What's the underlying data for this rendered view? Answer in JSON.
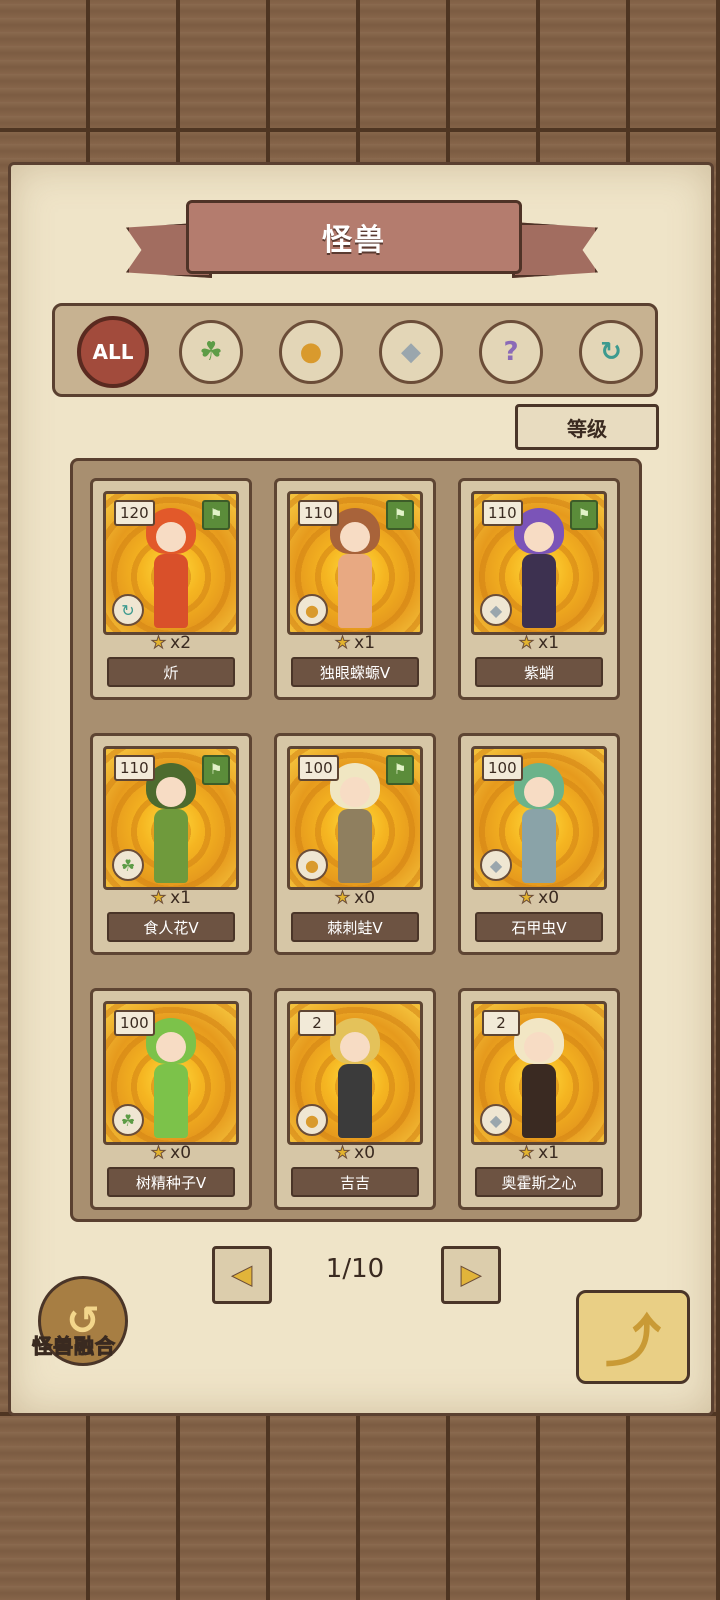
{
  "title": "怪兽",
  "filters": [
    {
      "label": "ALL",
      "icon": "all-icon",
      "active": true
    },
    {
      "label": "",
      "icon": "leaf-icon",
      "active": false
    },
    {
      "label": "",
      "icon": "paw-icon",
      "active": false
    },
    {
      "label": "",
      "icon": "crystal-icon",
      "active": false
    },
    {
      "label": "",
      "icon": "question-icon",
      "active": false
    },
    {
      "label": "",
      "icon": "swirl-icon",
      "active": false
    }
  ],
  "sort_label": "等级",
  "monsters": [
    {
      "level": "120",
      "count": "x2",
      "name": "炘",
      "type_icon": "swirl-icon",
      "flag": true,
      "hair": "#e2592a",
      "body": "#d9502a"
    },
    {
      "level": "110",
      "count": "x1",
      "name": "独眼蝾螈V",
      "type_icon": "paw-icon",
      "flag": true,
      "hair": "#a8633a",
      "body": "#e8a982"
    },
    {
      "level": "110",
      "count": "x1",
      "name": "紫蛸",
      "type_icon": "crystal-icon",
      "flag": true,
      "hair": "#7b54b8",
      "body": "#3d3150"
    },
    {
      "level": "110",
      "count": "x1",
      "name": "食人花V",
      "type_icon": "leaf-icon",
      "flag": true,
      "hair": "#4d6b2e",
      "body": "#6f9a3c"
    },
    {
      "level": "100",
      "count": "x0",
      "name": "棘刺蛙V",
      "type_icon": "paw-icon",
      "flag": true,
      "hair": "#f0e6c2",
      "body": "#8f7f5f"
    },
    {
      "level": "100",
      "count": "x0",
      "name": "石甲虫V",
      "type_icon": "crystal-icon",
      "flag": false,
      "hair": "#6bb38a",
      "body": "#8aa3a8"
    },
    {
      "level": "100",
      "count": "x0",
      "name": "树精种子V",
      "type_icon": "leaf-icon",
      "flag": false,
      "hair": "#7cc24a",
      "body": "#7cc24a"
    },
    {
      "level": "2",
      "count": "x0",
      "name": "吉吉",
      "type_icon": "paw-icon",
      "flag": false,
      "hair": "#e4c25a",
      "body": "#3b3b3b"
    },
    {
      "level": "2",
      "count": "x1",
      "name": "奥霍斯之心",
      "type_icon": "crystal-icon",
      "flag": false,
      "hair": "#f2e6c4",
      "body": "#3a2a22"
    }
  ],
  "page": "1/10",
  "fusion_label": "怪兽融合",
  "icons": {
    "prev": "‹",
    "next": "›"
  },
  "colors": {
    "accent": "#a24b3c",
    "ribbon": "#b47c6e",
    "card_name_bg": "#6d5342",
    "star": "#e3b32e"
  }
}
